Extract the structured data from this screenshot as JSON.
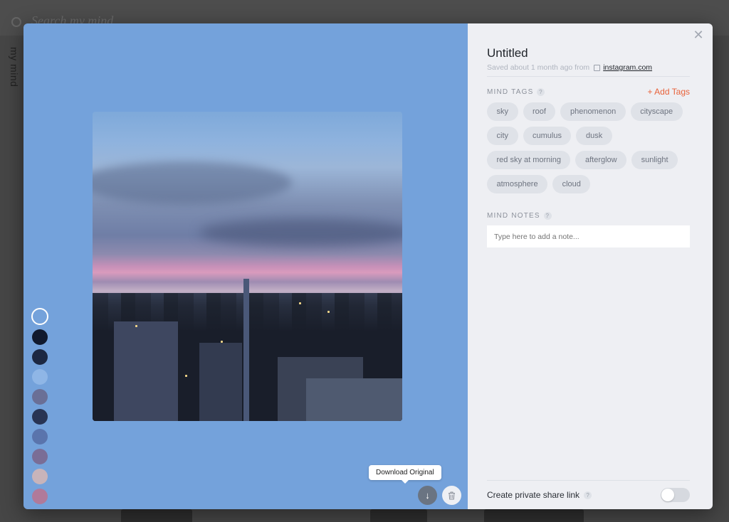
{
  "background": {
    "search_placeholder": "Search my mind",
    "sidebar_label": "my mind"
  },
  "viewer": {
    "swatch_colors": [
      "#74a2db",
      "#111a2e",
      "#1c2842",
      "#8fb6e6",
      "#6a6f96",
      "#283454",
      "#5a74ac",
      "#7a6d96",
      "#c8b4ba",
      "#b07a9a"
    ],
    "tooltip": "Download Original",
    "download_icon": "download-icon",
    "trash_icon": "trash-icon"
  },
  "detail": {
    "close_icon": "close-icon",
    "title": "Untitled",
    "saved_text": "Saved about 1 month ago from",
    "source_link": "instagram.com",
    "mind_tags_label": "MIND TAGS",
    "add_tags_label": "+ Add Tags",
    "tags": [
      "sky",
      "roof",
      "phenomenon",
      "cityscape",
      "city",
      "cumulus",
      "dusk",
      "red sky at morning",
      "afterglow",
      "sunlight",
      "atmosphere",
      "cloud"
    ],
    "mind_notes_label": "MIND NOTES",
    "notes_placeholder": "Type here to add a note...",
    "share_label": "Create private share link",
    "share_enabled": false,
    "help_glyph": "?"
  },
  "colors": {
    "accent": "#e8623a",
    "panel_bg": "#eeeff3",
    "viewer_bg": "#74a2db"
  }
}
